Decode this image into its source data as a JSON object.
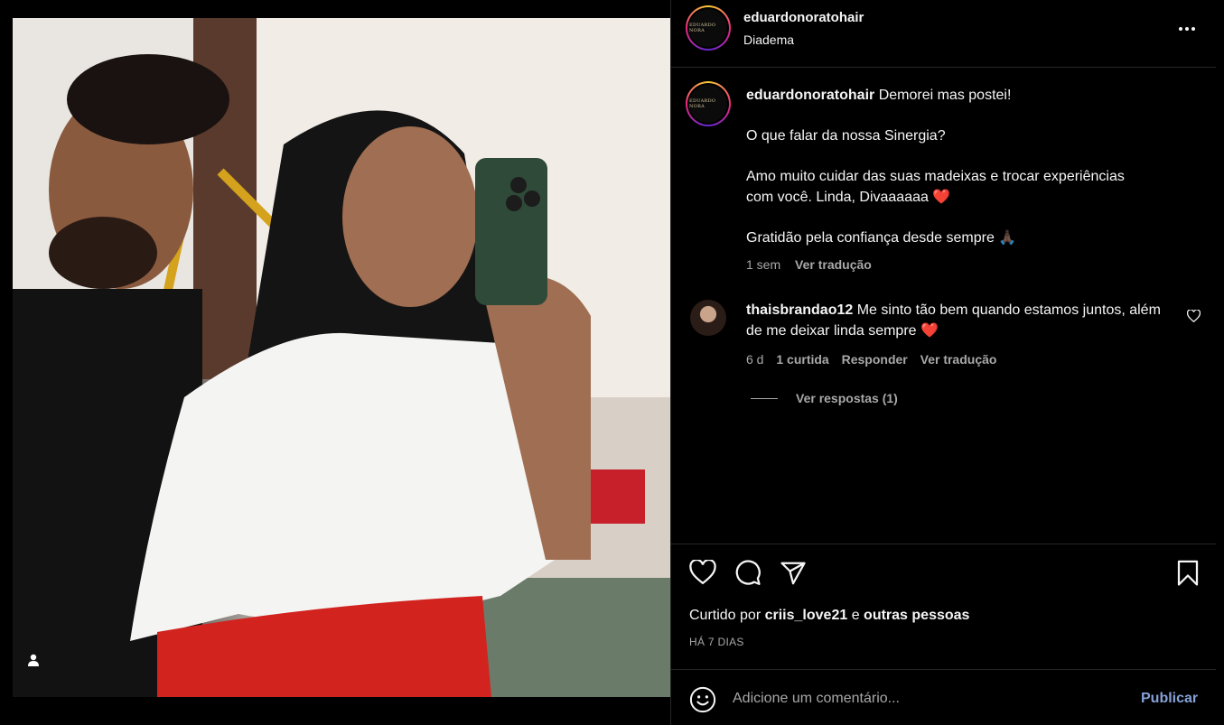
{
  "post": {
    "author": "eduardonoratohair",
    "location": "Diadema",
    "logo_text": "EDUARDO NORA",
    "caption_paragraphs": [
      "Demorei mas postei!",
      "O que falar da nossa Sinergia?",
      "Amo muito cuidar das suas madeixas e trocar experiências com você. Linda, Divaaaaaa ❤️",
      "Gratidão pela confiança desde sempre 🙏🏿"
    ],
    "caption_time": "1 sem",
    "caption_translate": "Ver tradução"
  },
  "comment": {
    "username": "thaisbrandao12",
    "text": "Me sinto tão bem quando estamos juntos, além de me deixar linda sempre ❤️",
    "time": "6 d",
    "likes": "1 curtida",
    "reply": "Responder",
    "translate": "Ver tradução",
    "view_replies": "Ver respostas (1)"
  },
  "likes": {
    "prefix": "Curtido por",
    "user": "criis_love21",
    "joiner": "e",
    "others": "outras pessoas"
  },
  "posted_ago": "HÁ 7 DIAS",
  "add_comment": {
    "placeholder": "Adicione um comentário...",
    "publish": "Publicar"
  },
  "icons": [
    "heart-icon",
    "comment-icon",
    "share-icon",
    "bookmark-icon",
    "emoji-icon",
    "more-icon",
    "user-tag-icon"
  ]
}
